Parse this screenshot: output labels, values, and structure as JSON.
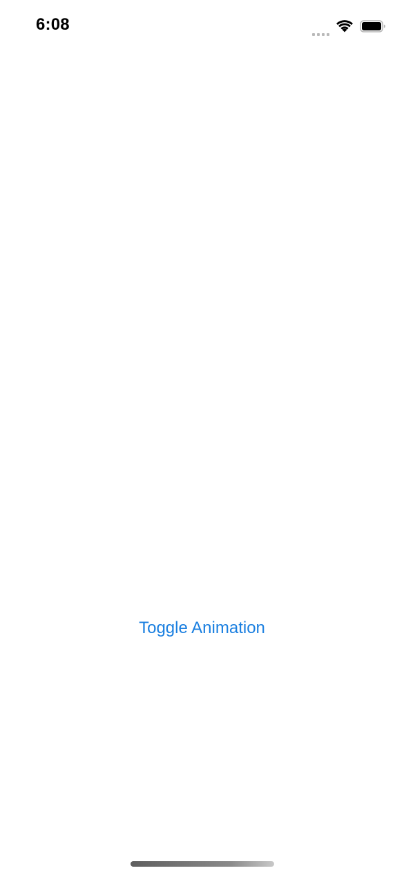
{
  "status_bar": {
    "time": "6:08",
    "icons": [
      "cellular-signal-icon",
      "wifi-icon",
      "battery-icon"
    ]
  },
  "main": {
    "toggle_button_label": "Toggle Animation"
  },
  "colors": {
    "accent": "#1a7fe0",
    "background": "#ffffff",
    "text": "#000000"
  }
}
